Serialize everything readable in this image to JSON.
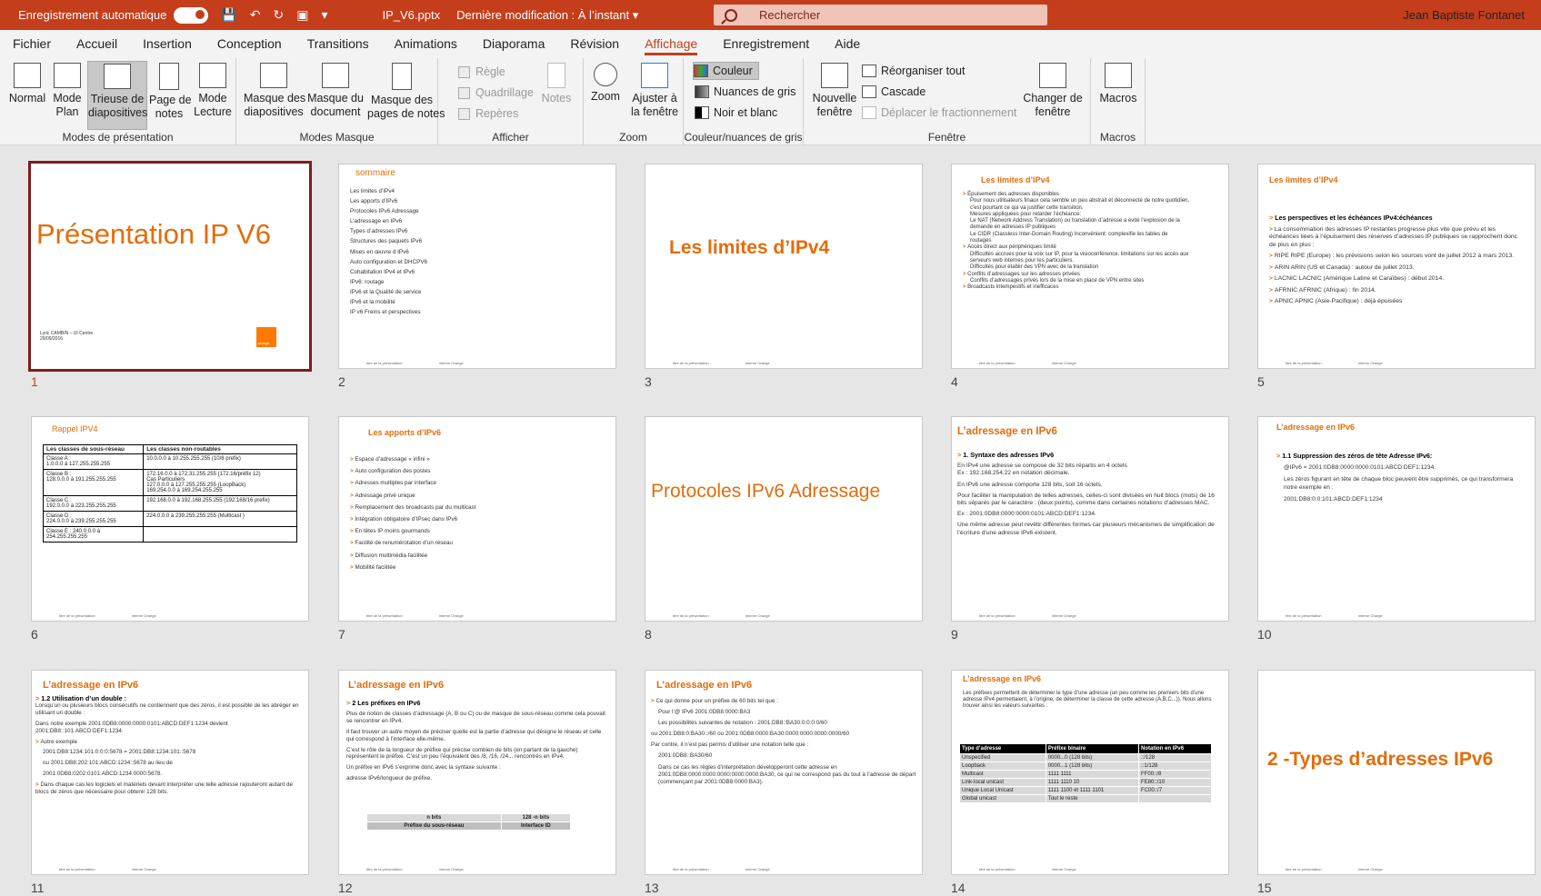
{
  "titlebar": {
    "autosave": "Enregistrement automatique",
    "filename": "IP_V6.pptx",
    "last_modified": "Dernière modification : À l’instant",
    "search_placeholder": "Rechercher",
    "user": "Jean Baptiste Fontanet",
    "accent": "#c43e1c"
  },
  "menu": [
    "Fichier",
    "Accueil",
    "Insertion",
    "Conception",
    "Transitions",
    "Animations",
    "Diaporama",
    "Révision",
    "Affichage",
    "Enregistrement",
    "Aide"
  ],
  "menu_active": "Affichage",
  "ribbon": {
    "groups": {
      "modes": "Modes de présentation",
      "masque": "Modes Masque",
      "afficher": "Afficher",
      "zoom": "Zoom",
      "couleur": "Couleur/nuances de gris",
      "fenetre": "Fenêtre",
      "macros": "Macros"
    },
    "modes": [
      "Normal",
      "Mode\nPlan",
      "Trieuse de\ndiapositives",
      "Page de\nnotes",
      "Mode\nLecture"
    ],
    "masque": [
      "Masque des\ndiapositives",
      "Masque du\ndocument",
      "Masque des\npages de notes"
    ],
    "afficher_checks": [
      "Règle",
      "Quadrillage",
      "Repères"
    ],
    "notes": "Notes",
    "zoom": [
      "Zoom",
      "Ajuster à\nla fenêtre"
    ],
    "couleur": [
      "Couleur",
      "Nuances de gris",
      "Noir et blanc"
    ],
    "nouvelle": "Nouvelle\nfenêtre",
    "fenetre_small": [
      "Réorganiser tout",
      "Cascade",
      "Déplacer le fractionnement"
    ],
    "changer": "Changer de\nfenêtre",
    "macros": "Macros"
  },
  "slides": {
    "s1": {
      "title": "Présentation IP V6",
      "footer1": "Lyric CAMBIN – UI Centre",
      "footer2": "29/09/2016",
      "logo": "orange",
      "num": "1"
    },
    "s2": {
      "title": "sommaire",
      "items": [
        "Les limites d’IPv4",
        "Les apports d’IPv6",
        "Protocoles IPv6 Adressage",
        "L’adressage en IPv6",
        "Types d’adresses IPv6",
        "Structures des paquets IPv6",
        "Mises en œuvre d IPv6",
        "Auto configuration et DHCPV6",
        "Cohabitation IPv4 et IPv6",
        "IPv6: routage",
        "IPv6 et la Qualité de service",
        "IPv6 et la mobilité",
        "IP v6 Freins et perspectives"
      ],
      "num": "2"
    },
    "s3": {
      "title": "Les limites d’IPv4",
      "num": "3"
    },
    "s4": {
      "title": "Les limites d’IPv4",
      "lines": [
        "Épuisement des adresses disponibles",
        "Pour nous utilisateurs finaux cela semble un peu abstrait et déconnecté de notre quotidien, c'est pourtant ce qui va justifier cette transition.",
        "Mesures appliquées pour retarder l’échéance:",
        "Le NAT (Network Address Translation) ou translation d’adresse a évité l’explosion de la demande en adresses IP publiques",
        "Le CIDR (Classless Inter-Domain Routing) Inconvénient: complexifie les tables de routages",
        "Accès direct aux périphériques limité",
        "Difficultés accrues pour la voix sur IP, pour la visioconférence. limitations sur les accès aux serveurs web internes pour les particuliers.",
        "Difficultés pour établir des VPN avec de la translation",
        "Conflits d’adressages sur les adresses privées",
        "Conflits d’adressages privés lors de la mise en place de VPN entre sites",
        "Broadcasts intempestifs et inefficaces"
      ],
      "num": "4"
    },
    "s5": {
      "title": "Les limites d’IPv4",
      "lines": [
        "Les perspectives et les échéances IPv4:échéances",
        "La consommation des adresses IP restantes progresse plus vite que prévu et les échéances liées à l’épuisement des réserves d’adresses IP publiques se rapprochent donc de plus en plus :",
        "RIPE RIPE (Europe) : les prévisions selon les sources vont de juillet 2012 à mars 2013.",
        "ARIN ARIN (US et Canada) : autour de juillet 2013.",
        "LACNIC LACNIC (Amérique Latine et Caraïbes) : début 2014.",
        "AFRNIC AFRNIC (Afrique) : fin 2014.",
        "APNIC APNIC (Asie-Pacifique) : déjà épuisées"
      ],
      "num": "5"
    },
    "s6": {
      "title": "Rappel IPV4",
      "headers": [
        "Les classes de sous-réseau",
        "Les classes non-routables"
      ],
      "rows": [
        [
          "Classe A :\n1.0.0.0 à 127.255.255.255",
          "10.0.0.0 à 10.255.255.255 (10/8 prefix)"
        ],
        [
          "Classe B :\n128.0.0.0 à 191.255.255.255",
          "172.16.0.0 à 172.31.255.255 (172.16/préfix 12)\nCas Particuliers\n127.0.0.0 à 127.255.255.255 (LoopBack)\n169.254.0.0 à 169.254.255.255"
        ],
        [
          "Classe C :\n192.0.0.0 à 223.255.255.255",
          "192.168.0.0 à 192.168.255.255 (192.168/16 prefix)"
        ],
        [
          "Classe D :\n224.0.0.0 à 239.255.255.255",
          "224.0.0.0 à 239.255.255.255 (Multicast )"
        ],
        [
          "Classe E : 240.0.0.0 à\n254.255.255.255",
          ""
        ]
      ],
      "num": "6"
    },
    "s7": {
      "title": "Les apports d’IPv6",
      "items": [
        "Espace d’adressage « infini »",
        "Auto configuration des postes",
        "Adresses multiples par interface",
        "Adressage privé unique",
        "Remplacement des broadcasts par du multicast",
        "Intégration obligatoire d’IPsec dans IPv6",
        "En têtes IP moins gourmands",
        "Facilité de renumérotation d’un réseau",
        "Diffusion multimédia facilitée",
        "Mobilité facilitée"
      ],
      "num": "7"
    },
    "s8": {
      "title": "Protocoles IPv6  Adressage",
      "num": "8"
    },
    "s9": {
      "title": "L’adressage en IPv6",
      "lines": [
        "1. Syntaxe des adresses IPv6",
        "En IPv4 une adresse se compose de 32 bits répartis en 4 octets",
        "Ex : 192.168.254.22 en notation décimale.",
        "En IPv6 une adresse comporte 128 bits, soit 16 octets.",
        "Pour faciliter la manipulation de telles adresses, celles-ci sont divisées en huit blocs (mots) de 16 bits séparés par le caractère : (deux points), comme dans certaines notations d’adresses MAC.",
        "Ex : 2001:0DB8:0000:0000:0101:ABCD:DEF1:1234.",
        "Une même adresse peut revêtir différentes formes car plusieurs mécanismes de simplification de l’écriture d’une adresse IPv6 existent."
      ],
      "num": "9"
    },
    "s10": {
      "title": "L’adressage en IPv6",
      "lines": [
        "1.1 Suppression des zéros de tête Adresse IPv6:",
        "@IPv6 = 2001:0DB8:0000:0000:0101:ABCD:DEF1:1234.",
        "Les zéros figurant en tête de chaque bloc peuvent être supprimés, ce qui transformera notre exemple en :",
        "2001:DB8:0:0:101:ABCD:DEF1:1234"
      ],
      "num": "10"
    },
    "s11": {
      "title": "L’adressage en IPv6",
      "lines": [
        "1.2 Utilisation d’un double :",
        "Lorsqu’un ou plusieurs blocs consécutifs ne contiennent que des zéros, il est possible de les abréger en utilisant un double :",
        "Dans notre exemple 2001:0DB8:0000:0000:0101:ABCD:DEF1:1234 devient 2001:DB8::101:ABCD:DEF1:1234.",
        "Autre exemple",
        "2001:DB8:1234:101:0:0:0:5678 = 2001:DB8:1234:101::5678",
        "ou 2001:DB8:202:101:ABCD:1234::5678 au lieu de",
        "2001:0DB8:0202:0101:ABCD:1234:0000:5678.",
        "Dans chaque cas les logiciels et matériels devant interpréter une telle adresse rajouteront autant de blocs de zéros que nécessaire pour obtenir 128 bits."
      ],
      "num": "11"
    },
    "s12": {
      "title": "L’adressage en IPv6",
      "lines": [
        "2 Les préfixes en IPv6",
        "Plus de notion de classes d’adressage (A, B ou C) ou de masque de sous-réseau comme cela pouvait se rencontrer en IPv4.",
        "Il faut trouver un autre moyen de préciser quelle est la partie d’adresse qui désigne le réseau et celle qui correspond à l’interface elle-même.",
        "C’est le rôle de la longueur de préfixe qui précise combien de bits (en partant de la gauche) représentent le préfixe. C’est un peu l’équivalent des /8, /16, /24... rencontrés en IPv4.",
        "Un préfixe en IPv6 s’exprime donc avec la syntaxe suivante :",
        "adresse IPv6/longueur de préfixe."
      ],
      "table": [
        [
          "n bits",
          "128 -n bits"
        ],
        [
          "Préfixe du sous-réseau",
          "Interface ID"
        ]
      ],
      "num": "12"
    },
    "s13": {
      "title": "L’adressage en IPv6",
      "lines": [
        "Ce qui donne pour un préfixe de 60 bits tel que :",
        "Pour l’@ IPv6  2001:0DB8:0000:BA3",
        "Les possibilités suivantes de notation : 2001:DB8::BA30:0:0:0:0/60",
        "ou 2001:DB8:0:BA30::/60 ou 2001:0DB8:0000:BA30:0000:0000:0000:0000/60",
        "Par contre, il n’est pas permis d’utiliser une notation telle que :",
        "2001:0DB8::BA30/60",
        "Dans ce cas les règles d’interprétation développeront cette adresse en 2001:0DB8:0000:0000:0000:0000:0000:BA30, ce qui ne correspond pas du tout à l’adresse de départ (commençant par 2001:0DB8:0000:BA3)."
      ],
      "num": "13"
    },
    "s14": {
      "title": "L’adressage en IPv6",
      "intro": "Les préfixes permettent de déterminer le type d’une adresse (un peu comme les premiers bits d’une adresse IPv4 permettaient, à l’origine, de déterminer la classe de cette adresse (A,B,C...)). Nous allons trouver ainsi les valeurs suivantes :",
      "headers": [
        "Type d’adresse",
        "Préfixe binaire",
        "Notation en IPv6"
      ],
      "rows": [
        [
          "Unspecified",
          "0000...0 (128 bits)",
          "::/128"
        ],
        [
          "Loopback",
          "0000...1 (128 bits)",
          "::1/128"
        ],
        [
          "Multicast",
          "1111 1111",
          "FF00::/8"
        ],
        [
          "Link-local unicast",
          "1111 1110 10",
          "FE80::/10"
        ],
        [
          "Unique Local Unicast",
          "1111 1100 et 1111 1101",
          "FC00::/7"
        ],
        [
          "Global unicast",
          "Tout le reste",
          ""
        ]
      ],
      "num": "14"
    },
    "s15": {
      "title": "2 -Types d’adresses IPv6",
      "num": "15"
    },
    "footer": {
      "left": "titre de la présentation",
      "right": "interne Orange"
    }
  }
}
